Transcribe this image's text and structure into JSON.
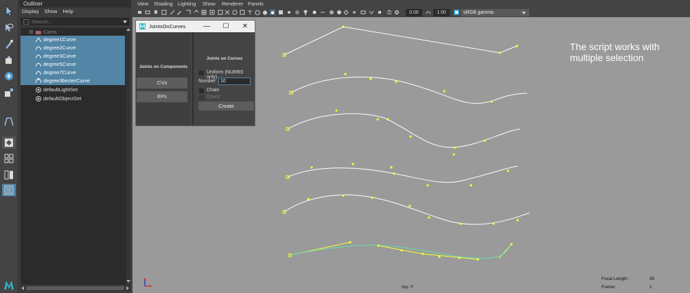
{
  "outliner": {
    "title": "Outliner",
    "menu": [
      "Display",
      "Show",
      "Help"
    ],
    "search_placeholder": "Search...",
    "items": [
      {
        "label": "Cams",
        "selected": false,
        "dim": true
      },
      {
        "label": "degree1Curve",
        "selected": true
      },
      {
        "label": "degree2Curve",
        "selected": true
      },
      {
        "label": "degree3Curve",
        "selected": true
      },
      {
        "label": "degree5Curve",
        "selected": true
      },
      {
        "label": "degree7Curve",
        "selected": true
      },
      {
        "label": "degree3bezierCurve",
        "selected": true
      },
      {
        "label": "defaultLightSet",
        "selected": false
      },
      {
        "label": "defaultObjectSet",
        "selected": false
      }
    ]
  },
  "viewport": {
    "menu": [
      "View",
      "Shading",
      "Lighting",
      "Show",
      "Renderer",
      "Panels"
    ],
    "exposure": "0.00",
    "gamma": "1.00",
    "color_space": "sRGB gamma",
    "camera_label": "top -Y",
    "note": "The script works with multiple selection",
    "hud": {
      "focal_label": "Focal Length:",
      "focal_value": "35",
      "frame_label": "Frame:",
      "frame_value": "1"
    }
  },
  "dialog": {
    "title": "JointsOnCurves",
    "controls": {
      "minimize": "—",
      "maximize": "☐",
      "close": "✕"
    },
    "left_header": "Joints on Components",
    "cvs_button": "CVs",
    "eps_button": "EPs",
    "right_header": "Joints on Curves",
    "uniform_label": "Uniform (NURBS only)",
    "number_label": "Number",
    "number_value": "10",
    "chain_label": "Chain",
    "orient_label": "Orient",
    "create_button": "Create"
  },
  "colors": {
    "selection": "#5285a6",
    "viewport_bg": "#9a9a9a",
    "curve": "#ffffff",
    "cv": "#ffff33",
    "bezier_curve": "#66e0b0"
  }
}
